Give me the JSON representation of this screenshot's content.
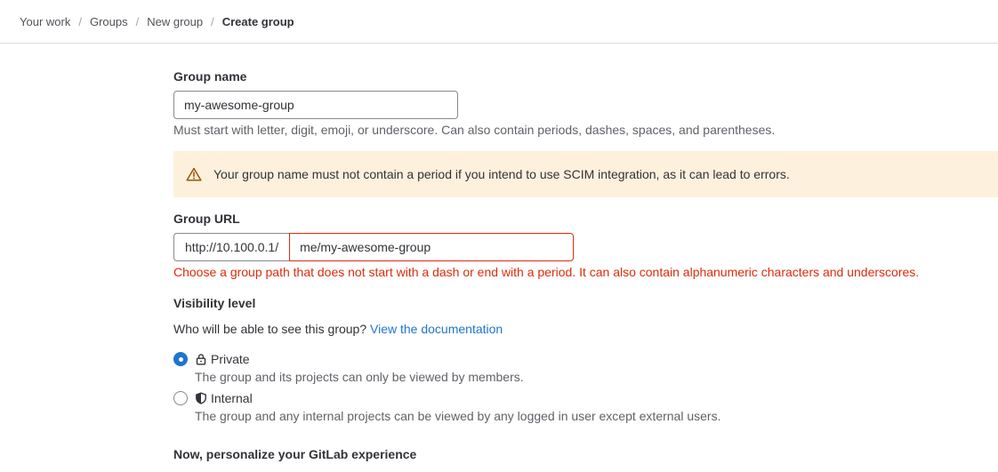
{
  "breadcrumb": {
    "items": [
      "Your work",
      "Groups",
      "New group"
    ],
    "current": "Create group",
    "separator": "/"
  },
  "group_name": {
    "label": "Group name",
    "value": "my-awesome-group",
    "help": "Must start with letter, digit, emoji, or underscore. Can also contain periods, dashes, spaces, and parentheses."
  },
  "warning": {
    "icon": "warning-icon",
    "text": "Your group name must not contain a period if you intend to use SCIM integration, as it can lead to errors."
  },
  "group_url": {
    "label": "Group URL",
    "prefix": "http://10.100.0.1/",
    "value": "me/my-awesome-group",
    "error": "Choose a group path that does not start with a dash or end with a period. It can also contain alphanumeric characters and underscores."
  },
  "visibility": {
    "label": "Visibility level",
    "question": "Who will be able to see this group?",
    "doc_link": "View the documentation",
    "options": [
      {
        "label": "Private",
        "icon": "lock-icon",
        "description": "The group and its projects can only be viewed by members.",
        "checked": true
      },
      {
        "label": "Internal",
        "icon": "shield-icon",
        "description": "The group and any internal projects can be viewed by any logged in user except external users.",
        "checked": false
      }
    ]
  },
  "personalize": {
    "heading": "Now, personalize your GitLab experience"
  },
  "colors": {
    "link": "#1f75cb",
    "error": "#dd2b0e",
    "warning_bg": "#fdf1dd",
    "warning_icon": "#9e5400"
  }
}
